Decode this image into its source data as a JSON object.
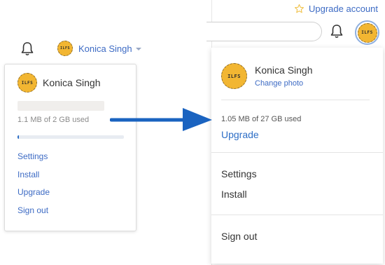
{
  "old_menu": {
    "user_name": "Konica Singh",
    "avatar_initials": "ILFS",
    "usage_text": "1.1 MB of 2 GB used",
    "usage_fraction": 0.0006,
    "items": [
      {
        "label": "Settings"
      },
      {
        "label": "Install"
      },
      {
        "label": "Upgrade"
      },
      {
        "label": "Sign out"
      }
    ]
  },
  "header": {
    "upgrade_label": "Upgrade account"
  },
  "new_menu": {
    "user_name": "Konica Singh",
    "avatar_initials": "ILFS",
    "change_photo": "Change photo",
    "usage_text": "1.05 MB of 27 GB used",
    "upgrade": "Upgrade",
    "items": [
      {
        "label": "Settings"
      },
      {
        "label": "Install"
      }
    ],
    "sign_out": "Sign out"
  },
  "colors": {
    "link": "#3d6bc4",
    "arrow": "#1a63c0",
    "avatar": "#f2b632",
    "star": "#f0c24a"
  },
  "icons": [
    "bell-icon",
    "star-icon",
    "caret-down-icon",
    "arrow-right-icon"
  ]
}
